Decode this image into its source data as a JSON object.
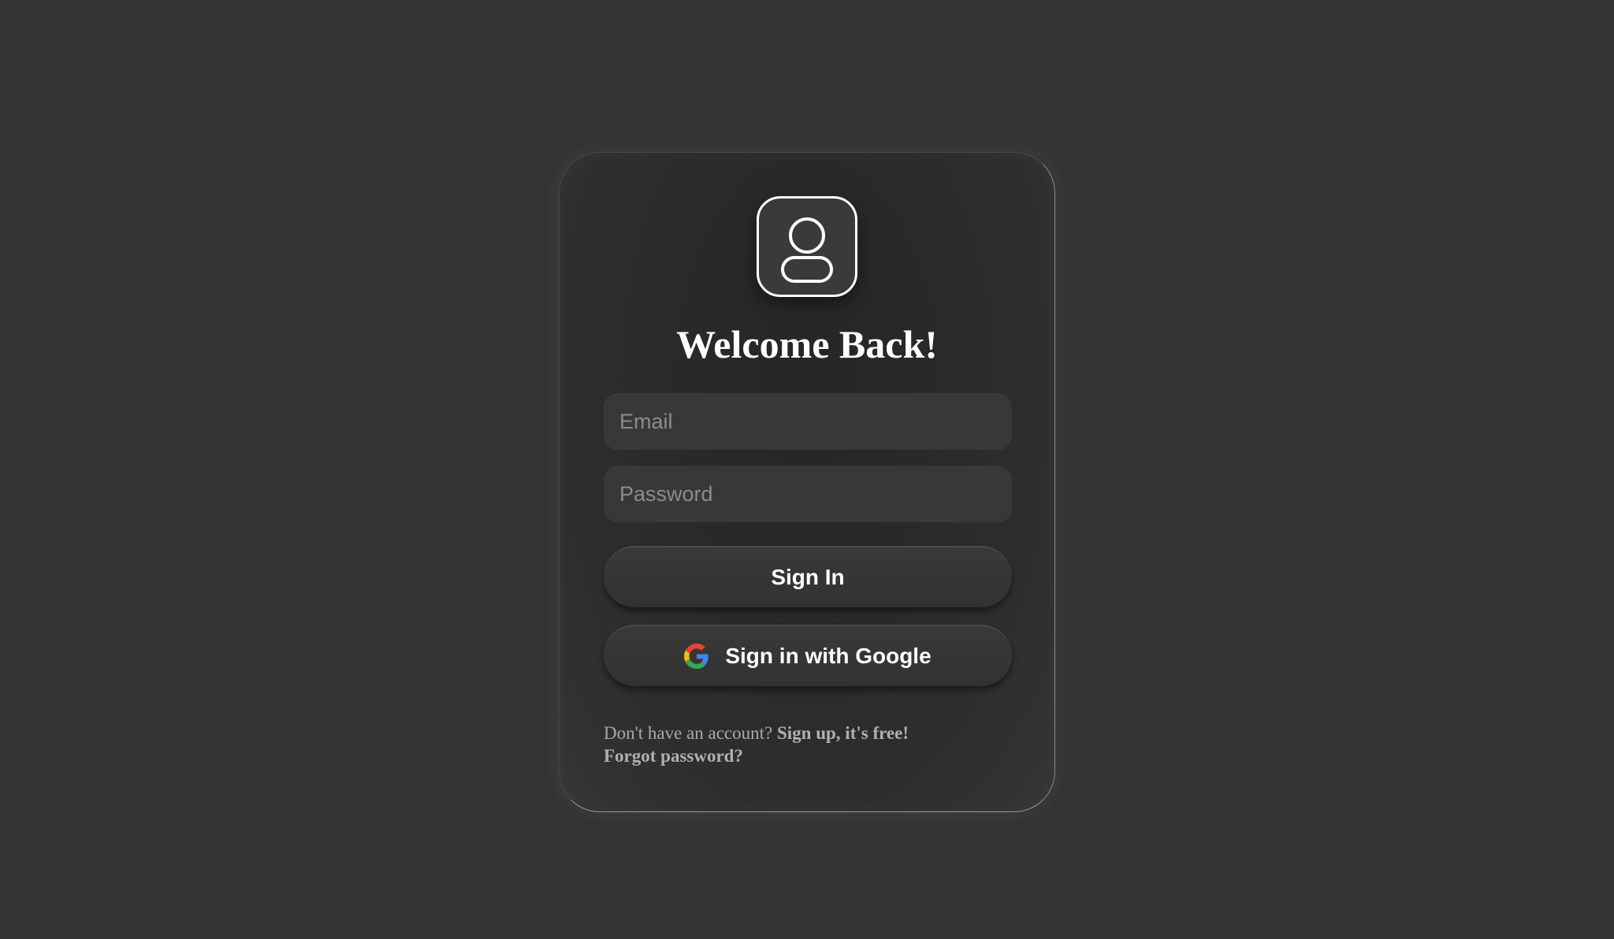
{
  "login": {
    "title": "Welcome Back!",
    "email_placeholder": "Email",
    "password_placeholder": "Password",
    "sign_in_label": "Sign In",
    "google_sign_in_label": "Sign in with Google",
    "signup_prompt": "Don't have an account?",
    "signup_link": "Sign up, it's free!",
    "forgot_password_link": "Forgot password?"
  },
  "icons": {
    "avatar": "user-icon",
    "google": "google-logo-icon"
  },
  "colors": {
    "background": "#333333",
    "card": "#2a2a2a",
    "input": "#383838",
    "text": "#ffffff",
    "muted_text": "#a9a9a9"
  }
}
